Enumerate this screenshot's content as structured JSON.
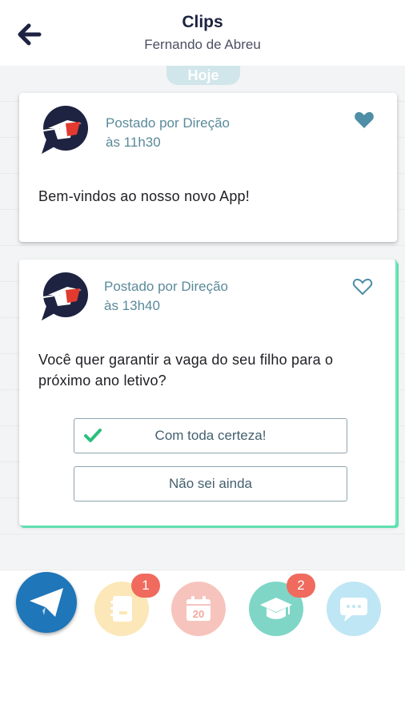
{
  "header": {
    "title": "Clips",
    "subtitle": "Fernando de Abreu",
    "back_icon": "arrow-left-icon"
  },
  "feed": {
    "date_label": "Hoje",
    "posts": [
      {
        "author_line": "Postado por Direção",
        "time": "às 11h30",
        "message": "Bem-vindos ao nosso novo App!",
        "liked": true
      },
      {
        "author_line": "Postado por Direção",
        "time": "às 13h40",
        "message": "Você quer garantir a vaga do seu filho para o próximo ano letivo?",
        "liked": false,
        "options": [
          {
            "label": "Com toda certeza!",
            "selected": true
          },
          {
            "label": "Não sei ainda",
            "selected": false
          }
        ]
      }
    ]
  },
  "nav": {
    "items": [
      {
        "icon": "paper-plane-icon",
        "badge": ""
      },
      {
        "icon": "notebook-icon",
        "badge": "1"
      },
      {
        "icon": "calendar-icon",
        "badge": "",
        "calendar_day": "20"
      },
      {
        "icon": "graduation-cap-icon",
        "badge": "2"
      },
      {
        "icon": "chat-bubble-icon",
        "badge": ""
      }
    ]
  },
  "colors": {
    "primary_dark": "#1d2340",
    "meta_text": "#5a8a9a",
    "heart": "#4e8ea6",
    "accent_green": "#6fe4b8",
    "badge": "#f06a5d"
  }
}
